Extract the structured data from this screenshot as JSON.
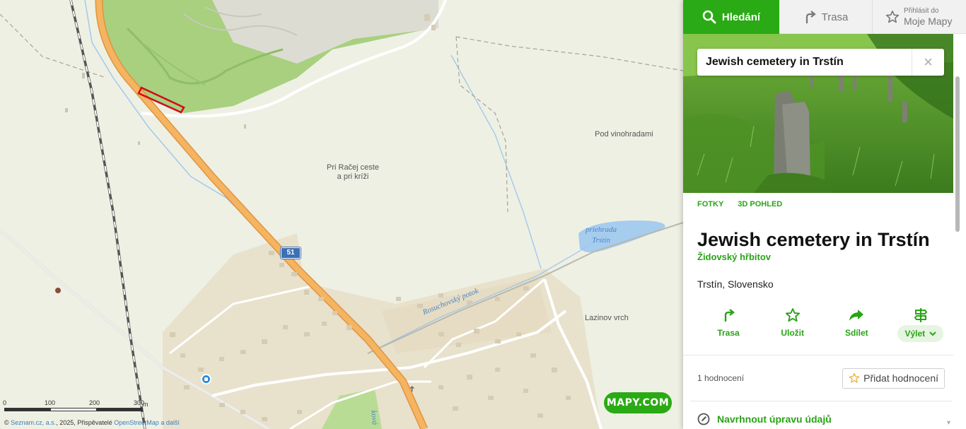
{
  "map": {
    "labels": {
      "pod_vinohradami": "Pod vinohradami",
      "pri_racej_1": "Pri Račej ceste",
      "pri_racej_2": "a pri kríži",
      "lazinov_vrch": "Lazinov vrch",
      "priehrada_1": "priehrada",
      "priehrada_2": "Trstín",
      "rosuchovsky_potok": "Rosuchovský potok",
      "street_partial": "ková"
    },
    "road_number": "51",
    "scale": {
      "ticks": [
        "0",
        "100",
        "200",
        "300"
      ],
      "unit": "m"
    },
    "attribution": {
      "prefix": "©",
      "seznam_link": "Seznam.cz, a.s.",
      "middle": ", 2025, Přispěvatelé",
      "osm_link": "OpenStreetMap",
      "suffix": "a další"
    },
    "logo": "MAPY.COM",
    "colors": {
      "background": "#eef0e4",
      "primary_road": "#f5b461",
      "forest": "#a7d07e",
      "water": "#9fc7ea",
      "settlement": "#e8e0cb",
      "highlight": "#d10a1a"
    }
  },
  "panel": {
    "tabs": {
      "search": "Hledání",
      "route": "Trasa",
      "login_top": "Přihlásit do",
      "login_bottom": "Moje Mapy"
    },
    "search": {
      "value": "Jewish cemetery in Trstín",
      "clear_icon": "close-icon"
    },
    "photo_links": {
      "photos": "FOTKY",
      "view3d": "3D POHLED"
    },
    "title": "Jewish cemetery in Trstín",
    "subtitle": "Židovský hřbitov",
    "address": "Trstín, Slovensko",
    "actions": {
      "route": "Trasa",
      "save": "Uložit",
      "share": "Sdílet",
      "trip": "Výlet"
    },
    "rating": {
      "count": "1 hodnocení",
      "add": "Přidat hodnocení"
    },
    "edit": "Navrhnout úpravu údajů",
    "colors": {
      "accent": "#2aaa14",
      "accent_text": "#2aa317"
    }
  }
}
